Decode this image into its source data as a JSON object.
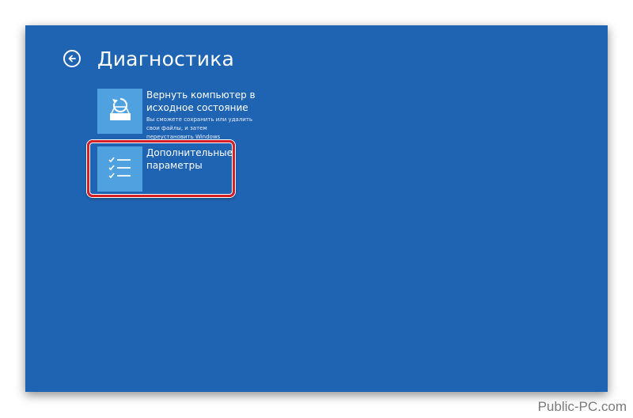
{
  "header": {
    "title": "Диагностика",
    "back_icon": "back-arrow-icon"
  },
  "options": [
    {
      "title": "Вернуть компьютер в исходное состояние",
      "description": "Вы сможете сохранить или удалить свои файлы, и затем переустановить Windows",
      "icon": "reset-pc-icon"
    },
    {
      "title": "Дополнительные параметры",
      "icon": "checklist-icon"
    }
  ],
  "watermark": "Public-PC.com",
  "colors": {
    "background": "#1f64b3",
    "tile": "#4fa1e0",
    "highlight": "#d41f26"
  }
}
